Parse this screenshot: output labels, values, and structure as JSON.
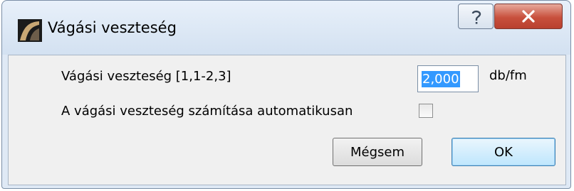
{
  "window": {
    "title": "Vágási veszteség",
    "app_icon": "archicad-icon",
    "help_icon": "question-mark-icon",
    "close_icon": "close-x-icon"
  },
  "form": {
    "loss_label": "Vágási veszteség [1,1-2,3]",
    "loss_value": "2,000",
    "loss_unit": "db/fm",
    "auto_label": "A vágási veszteség számítása automatikusan",
    "auto_checked": false
  },
  "buttons": {
    "cancel": "Mégsem",
    "ok": "OK"
  },
  "colors": {
    "selection": "#3399ff",
    "close_button": "#c8503d",
    "frame": "#dfe9f5"
  }
}
